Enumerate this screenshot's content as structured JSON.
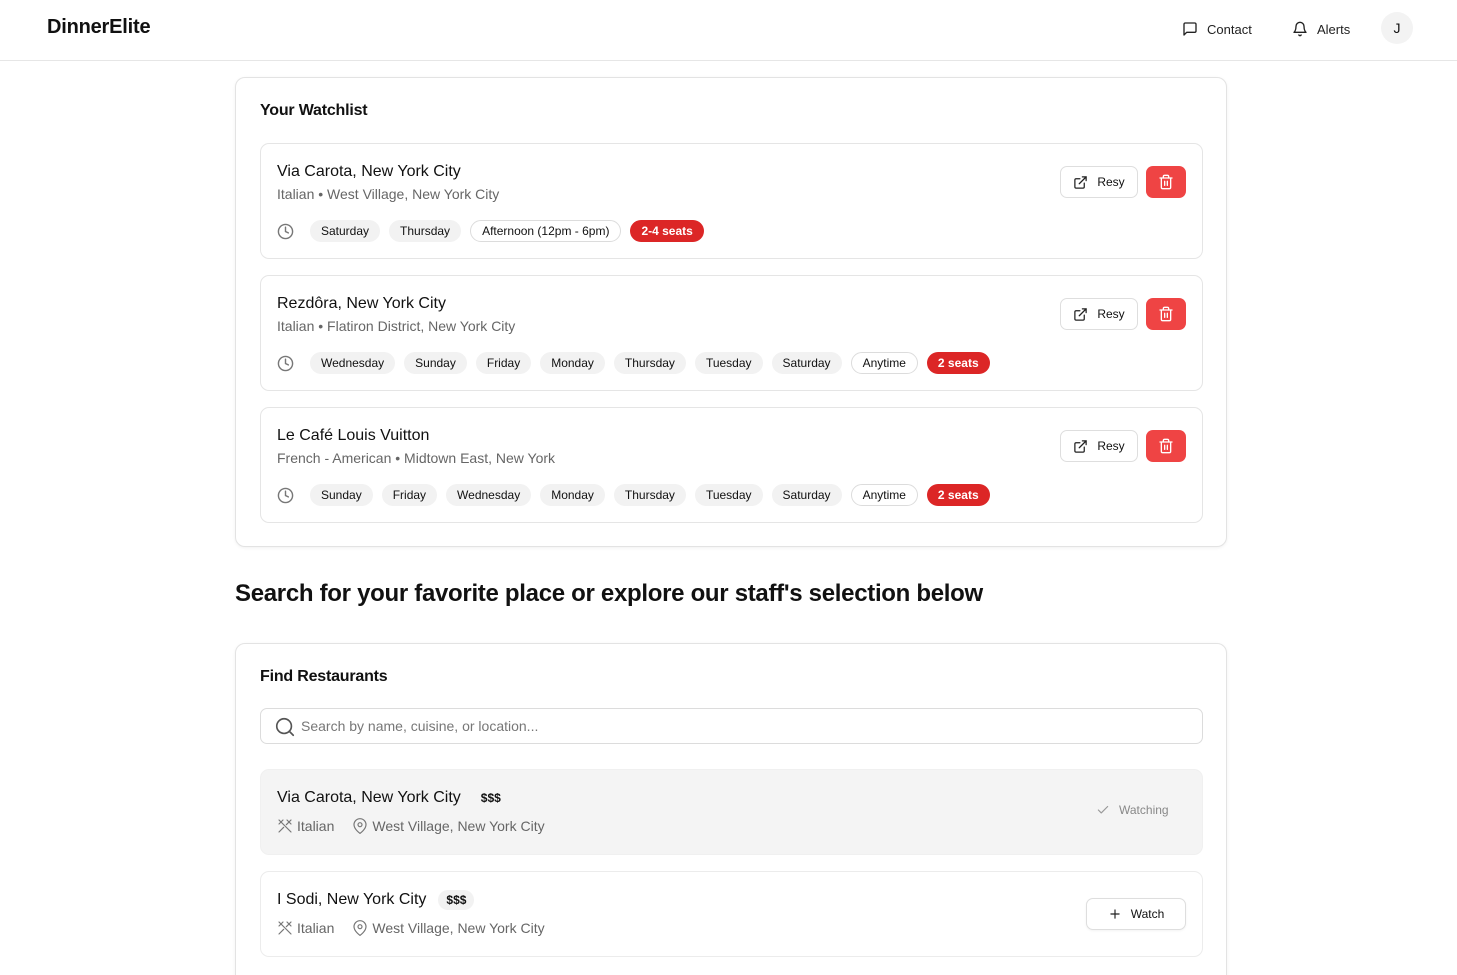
{
  "header": {
    "brand": "DinnerElite",
    "contact_label": "Contact",
    "alerts_label": "Alerts",
    "avatar_initial": "J"
  },
  "watchlist": {
    "title": "Your Watchlist",
    "resy_label": "Resy",
    "items": [
      {
        "name": "Via Carota, New York City",
        "meta": "Italian • West Village, New York City",
        "days": [
          "Saturday",
          "Thursday"
        ],
        "time": "Afternoon (12pm - 6pm)",
        "seats": "2-4 seats"
      },
      {
        "name": "Rezdôra, New York City",
        "meta": "Italian • Flatiron District, New York City",
        "days": [
          "Wednesday",
          "Sunday",
          "Friday",
          "Monday",
          "Thursday",
          "Tuesday",
          "Saturday"
        ],
        "time": "Anytime",
        "seats": "2 seats"
      },
      {
        "name": "Le Café Louis Vuitton",
        "meta": "French - American • Midtown East, New York",
        "days": [
          "Sunday",
          "Friday",
          "Wednesday",
          "Monday",
          "Thursday",
          "Tuesday",
          "Saturday"
        ],
        "time": "Anytime",
        "seats": "2 seats"
      }
    ]
  },
  "explore_heading": "Search for your favorite place or explore our staff's selection below",
  "find": {
    "title": "Find Restaurants",
    "search_placeholder": "Search by name, cuisine, or location...",
    "search_value": "",
    "watching_label": "Watching",
    "watch_label": "Watch",
    "results": [
      {
        "name": "Via Carota, New York City",
        "price": "$$$",
        "cuisine": "Italian",
        "location": "West Village, New York City",
        "watching": true
      },
      {
        "name": "I Sodi, New York City",
        "price": "$$$",
        "cuisine": "Italian",
        "location": "West Village, New York City",
        "watching": false
      }
    ]
  },
  "colors": {
    "seats_badge": "#dc2626",
    "delete_button": "#ef4444",
    "border": "#e5e5e5"
  },
  "icons": {
    "contact": "message-square-icon",
    "alerts": "bell-icon",
    "time": "clock-icon",
    "resy": "external-link-icon",
    "delete": "trash-icon",
    "search": "search-icon",
    "cuisine": "utensils-icon",
    "location": "map-pin-icon",
    "watching": "check-icon",
    "watch": "plus-icon"
  }
}
